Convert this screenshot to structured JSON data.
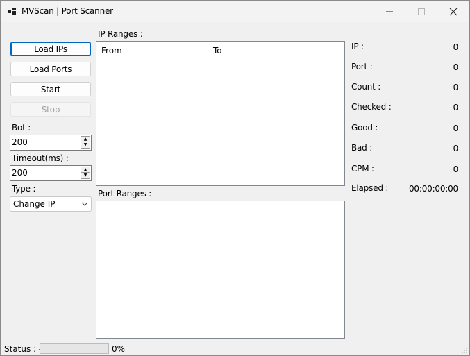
{
  "window": {
    "title": "MVScan | Port Scanner"
  },
  "buttons": {
    "load_ips": "Load IPs",
    "load_ports": "Load Ports",
    "start": "Start",
    "stop": "Stop"
  },
  "settings": {
    "bot_label": "Bot :",
    "bot_value": "200",
    "timeout_label": "Timeout(ms) :",
    "timeout_value": "200",
    "type_label": "Type :",
    "type_value": "Change IP"
  },
  "ip_ranges": {
    "label": "IP Ranges :",
    "columns": [
      "From",
      "To"
    ]
  },
  "port_ranges": {
    "label": "Port Ranges :"
  },
  "stats": [
    {
      "label": "IP :",
      "value": "0"
    },
    {
      "label": "Port :",
      "value": "0"
    },
    {
      "label": "Count :",
      "value": "0"
    },
    {
      "label": "Checked :",
      "value": "0"
    },
    {
      "label": "Good :",
      "value": "0"
    },
    {
      "label": "Bad :",
      "value": "0"
    },
    {
      "label": "CPM :",
      "value": "0"
    },
    {
      "label": "Elapsed :",
      "value": "00:00:00:00"
    }
  ],
  "status": {
    "label": "Status : -",
    "progress": 0,
    "percent_text": "0%"
  },
  "icons": {
    "app": "app-icon",
    "minimize": "minimize-icon",
    "maximize": "maximize-icon",
    "close": "close-icon",
    "dropdown": "chevron-down-icon",
    "spin_up": "spin-up-icon",
    "spin_down": "spin-down-icon",
    "resize_grip": "resize-grip-icon"
  },
  "colors": {
    "accent": "#0067c0",
    "progress_fill": "#06b025"
  }
}
